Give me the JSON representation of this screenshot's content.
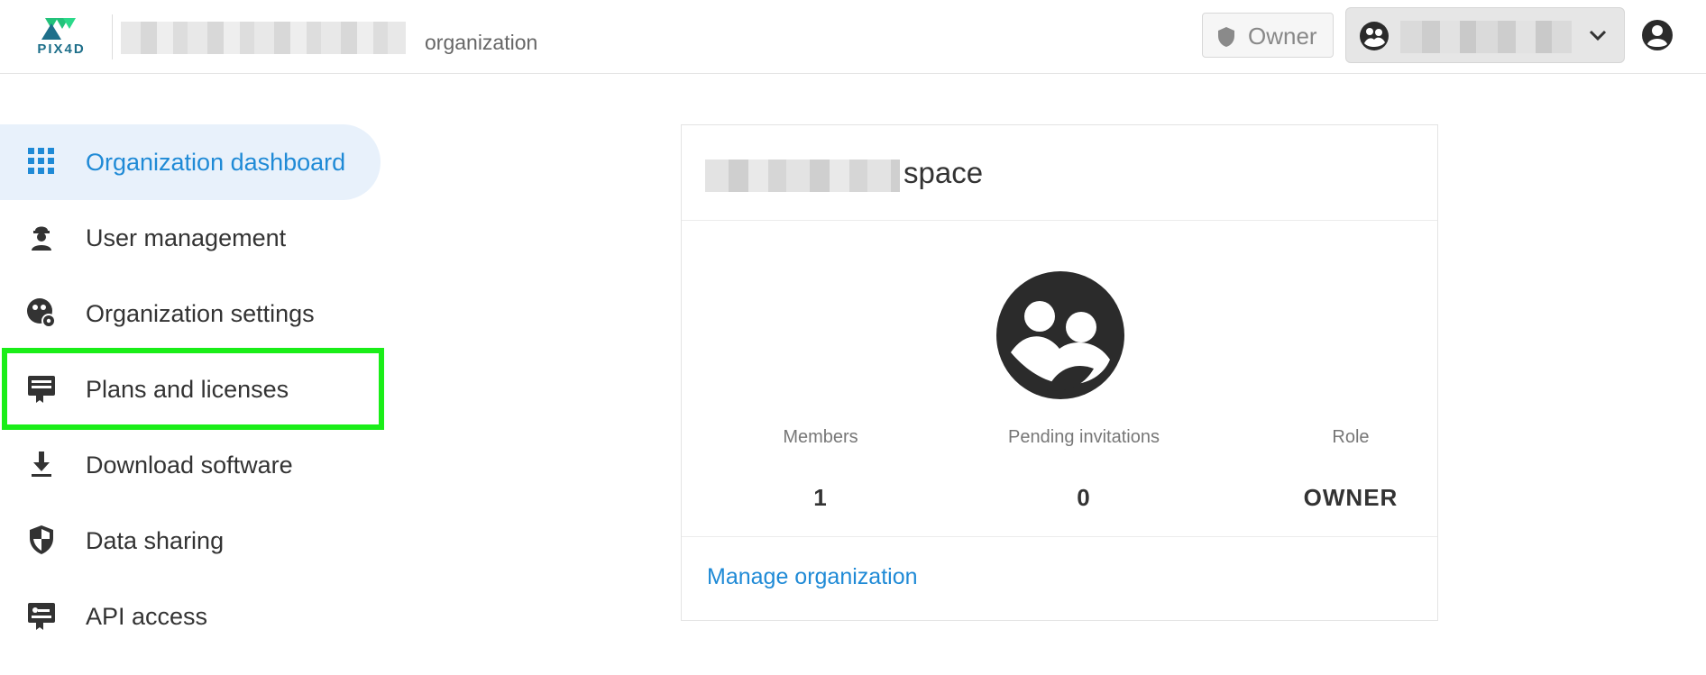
{
  "header": {
    "logo_text": "PIX4D",
    "org_label": "organization",
    "role_chip": "Owner"
  },
  "sidebar": {
    "items": [
      {
        "label": "Organization dashboard",
        "icon": "grid-icon",
        "active": true
      },
      {
        "label": "User management",
        "icon": "worker-icon"
      },
      {
        "label": "Organization settings",
        "icon": "org-settings-icon"
      },
      {
        "label": "Plans and licenses",
        "icon": "license-icon"
      },
      {
        "label": "Download software",
        "icon": "download-icon"
      },
      {
        "label": "Data sharing",
        "icon": "shield-half-icon"
      },
      {
        "label": "API access",
        "icon": "api-icon"
      }
    ]
  },
  "card": {
    "title_suffix": "space",
    "stats": [
      {
        "label": "Members",
        "value": "1"
      },
      {
        "label": "Pending invitations",
        "value": "0"
      },
      {
        "label": "Role",
        "value": "OWNER"
      }
    ],
    "manage_link": "Manage organization"
  },
  "colors": {
    "accent": "#1f8ad6",
    "active_bg": "#e8f1fb",
    "highlight": "#1aee18",
    "logo": "#23c27a"
  }
}
